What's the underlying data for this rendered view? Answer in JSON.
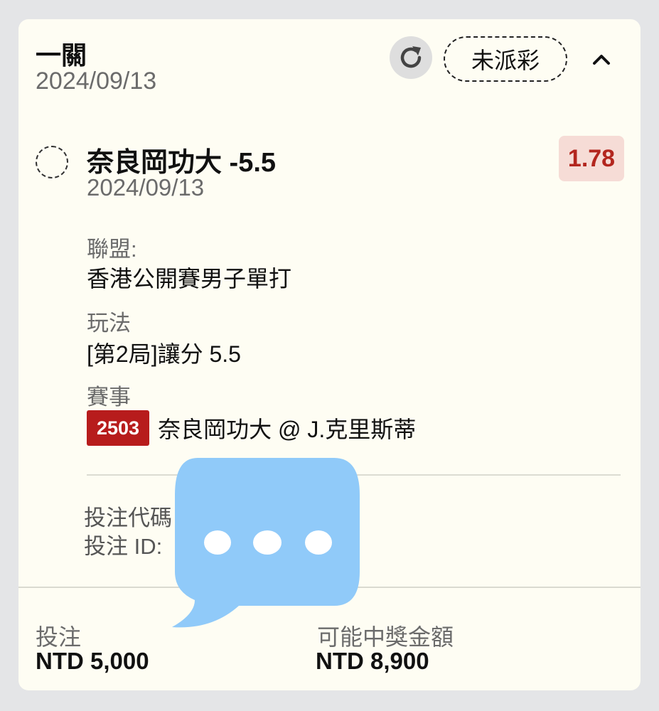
{
  "header": {
    "bet_type": "一關",
    "date": "2024/09/13",
    "status": "未派彩"
  },
  "selection": {
    "title": "奈良岡功大 -5.5",
    "date": "2024/09/13",
    "odds": "1.78",
    "league_label": "聯盟:",
    "league_value": "香港公開賽男子單打",
    "market_label": "玩法",
    "market_value": "[第2局]讓分 5.5",
    "event_label": "賽事",
    "event_badge": "2503",
    "event_value": "奈良岡功大 @ J.克里斯蒂"
  },
  "bet_info": {
    "code_label": "投注代碼",
    "id_label": "投注 ID:"
  },
  "footer": {
    "stake_label": "投注",
    "stake_value": "NTD 5,000",
    "payout_label": "可能中獎金額",
    "payout_value": "NTD 8,900"
  },
  "colors": {
    "odds_bg": "#f6dcd6",
    "odds_text": "#b3261e",
    "badge_bg": "#b71c1c",
    "bubble": "#90caf9"
  },
  "icons": {
    "refresh": "refresh-icon",
    "collapse": "chevron-up-icon",
    "overlay": "chat-bubble-icon"
  }
}
